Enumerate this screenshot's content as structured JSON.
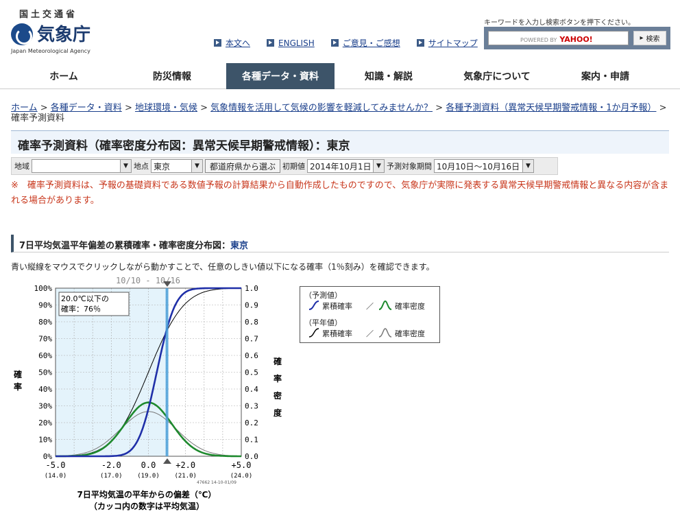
{
  "header": {
    "ministry": "国土交通省",
    "agency": "気象庁",
    "agency_en": "Japan Meteorological Agency",
    "links": [
      "本文へ",
      "ENGLISH",
      "ご意見・ご感想",
      "サイトマップ"
    ],
    "search_note": "キーワードを入力し検索ボタンを押下ください。",
    "search_placeholder": "POWERED BY",
    "search_brand": "YAHOO!",
    "search_button": "検索"
  },
  "nav": {
    "items": [
      "ホーム",
      "防災情報",
      "各種データ・資料",
      "知識・解説",
      "気象庁について",
      "案内・申請"
    ],
    "selected_index": 2
  },
  "breadcrumb": {
    "items": [
      "ホーム",
      "各種データ・資料",
      "地球環境・気候",
      "気象情報を活用して気候の影響を軽減してみませんか？",
      "各種予測資料（異常天候早期警戒情報・1か月予報）"
    ],
    "current": "確率予測資料"
  },
  "page_title": "確率予測資料（確率密度分布図：異常天候早期警戒情報）：東京",
  "controls": {
    "region_label": "地域",
    "region_value": "",
    "point_label": "地点",
    "point_value": "東京",
    "pref_button": "都道府県から選ぶ",
    "init_label": "初期値",
    "init_value": "2014年10月1日",
    "period_label": "予測対象期間",
    "period_value": "10月10日〜10月16日"
  },
  "warning": "※　確率予測資料は、予報の基礎資料である数値予報の計算結果から自動作成したものですので、気象庁が実際に発表する異常天候早期警戒情報と異なる内容が含まれる場合があります。",
  "section": {
    "title": "7日平均気温平年偏差の累積確率・確率密度分布図：",
    "city": "東京"
  },
  "description": "青い縦線をマウスでクリックしながら動かすことで、任意のしきい値以下になる確率（1％刻み）を確認できます。",
  "chart_data": {
    "type": "line",
    "period_label": "10/10 - 10/16",
    "tooltip": [
      "20.0℃以下の",
      "確率：76％"
    ],
    "threshold_x": 1.0,
    "threshold_prob": 76,
    "xlim": [
      -5.0,
      5.0
    ],
    "x_ticks": [
      "-5.0",
      "-2.0",
      "0.0",
      "+2.0",
      "+5.0"
    ],
    "x_tick_values": [
      -5.0,
      -2.0,
      0.0,
      2.0,
      5.0
    ],
    "x_subticks": [
      "(14.0)",
      "(17.0)",
      "(19.0)",
      "(21.0)",
      "(24.0)"
    ],
    "left_ticks": [
      "100%",
      "90%",
      "80%",
      "70%",
      "60%",
      "50%",
      "40%",
      "30%",
      "20%",
      "10%",
      "0%"
    ],
    "right_ticks": [
      "1.0",
      "0.9",
      "0.8",
      "0.7",
      "0.6",
      "0.5",
      "0.4",
      "0.3",
      "0.2",
      "0.1",
      "0.0"
    ],
    "ylabel_left": "確率",
    "ylabel_right": "確率密度",
    "xlabel": [
      "7日平均気温の平年からの偏差（℃）",
      "（カッコ内の数字は平均気温）"
    ],
    "footnote": "47662 14-10-01/09",
    "series": [
      {
        "name": "累積確率",
        "group": "予測値",
        "kind": "cdf",
        "color": "#1f2fa8",
        "mean": 0.45,
        "sd": 0.78
      },
      {
        "name": "確率密度",
        "group": "予測値",
        "kind": "pdf",
        "color": "#1e8a2e",
        "mean": 0.0,
        "sd": 1.25,
        "peak": 0.32
      },
      {
        "name": "累積確率",
        "group": "平年値",
        "kind": "cdf",
        "color": "#000000",
        "mean": 0.0,
        "sd": 1.5
      },
      {
        "name": "確率密度",
        "group": "平年値",
        "kind": "pdf",
        "color": "#777777",
        "mean": 0.0,
        "sd": 1.5,
        "peak": 0.266
      }
    ]
  },
  "legend": {
    "forecast_label": "（予測値）",
    "normal_label": "（平年値）",
    "cdf_label": "累積確率",
    "pdf_label": "確率密度",
    "separator": "／"
  }
}
